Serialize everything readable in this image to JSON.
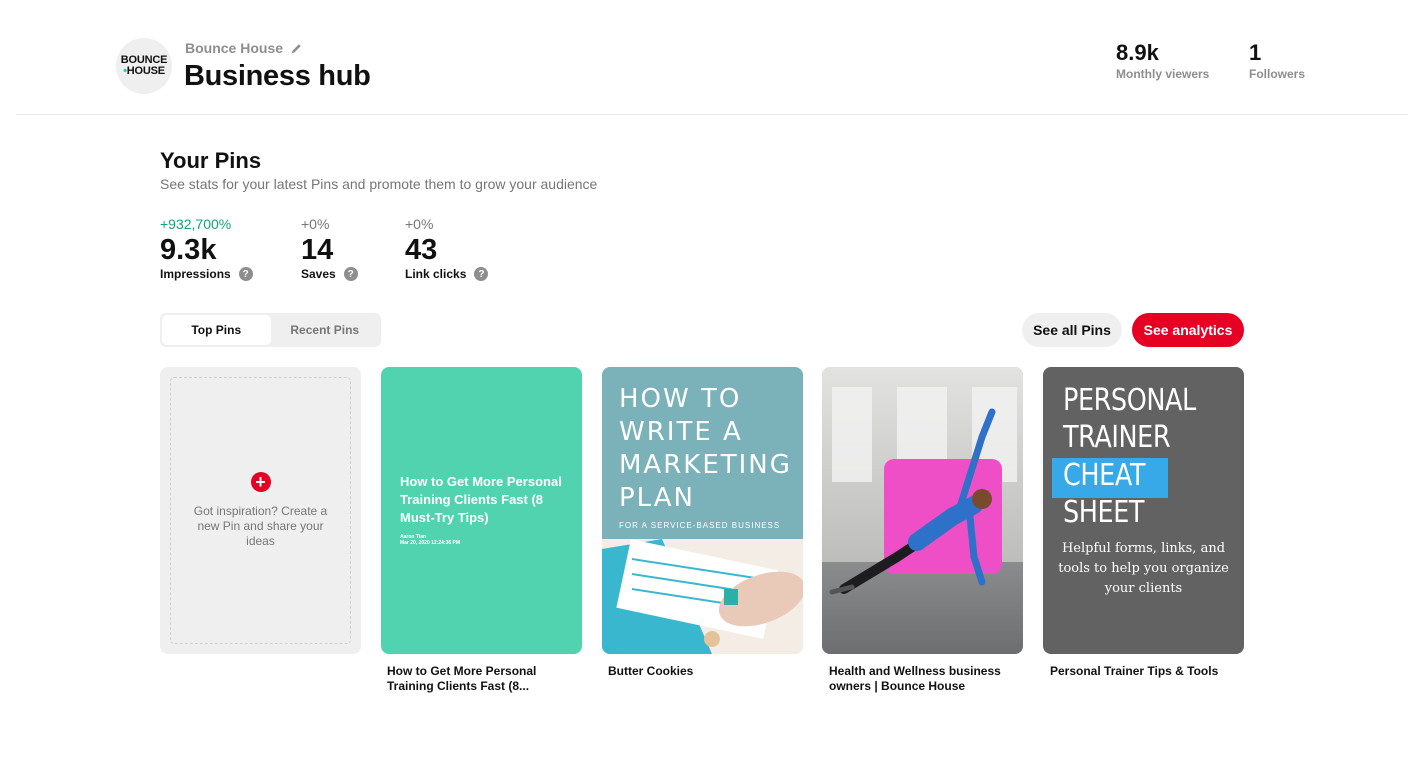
{
  "header": {
    "logo_top": "BOUNCE",
    "logo_bottom": "HOUSE",
    "business_name": "Bounce House",
    "title": "Business hub",
    "stats": [
      {
        "value": "8.9k",
        "label": "Monthly viewers"
      },
      {
        "value": "1",
        "label": "Followers"
      }
    ]
  },
  "pins_section": {
    "title": "Your Pins",
    "subtitle": "See stats for your latest Pins and promote them to grow your audience",
    "metrics": [
      {
        "delta": "+932,700%",
        "value": "9.3k",
        "label": "Impressions"
      },
      {
        "delta": "+0%",
        "value": "14",
        "label": "Saves"
      },
      {
        "delta": "+0%",
        "value": "43",
        "label": "Link clicks"
      }
    ],
    "tabs": [
      {
        "label": "Top Pins",
        "active": true
      },
      {
        "label": "Recent Pins",
        "active": false
      }
    ],
    "see_all_label": "See all Pins",
    "analytics_label": "See analytics",
    "create_text": "Got inspiration? Create a new Pin and share your ideas",
    "pins": [
      {
        "title": "How to Get More Personal Training Clients Fast (8...",
        "image_text": "How to Get More Personal Training Clients Fast (8 Must-Try Tips)",
        "image_meta_1": "Aaron Tian",
        "image_meta_2": "Mar 20, 2020 12:24:36 PM"
      },
      {
        "title": "Butter Cookies",
        "image_lines": [
          "HOW TO",
          "WRITE A",
          "MARKETING",
          "PLAN"
        ],
        "image_sub": "FOR A SERVICE-BASED BUSINESS"
      },
      {
        "title": "Health and Wellness business owners | Bounce House"
      },
      {
        "title": "Personal Trainer Tips & Tools",
        "image_lines": [
          "PERSONAL",
          "TRAINER",
          "CHEAT",
          "SHEET"
        ],
        "image_desc": "Helpful forms, links, and tools to help you organize your clients"
      }
    ]
  },
  "colors": {
    "brand_red": "#e60023",
    "positive_green": "#0fa573",
    "pin1_bg": "#52d3b0",
    "pin2_bg": "#7bb1b9",
    "pin4_bg": "#626262",
    "pin4_highlight": "#37a8e8",
    "pin3_accent": "#ee4fc6"
  },
  "icons": [
    "pencil-icon",
    "help-icon",
    "plus-icon"
  ]
}
